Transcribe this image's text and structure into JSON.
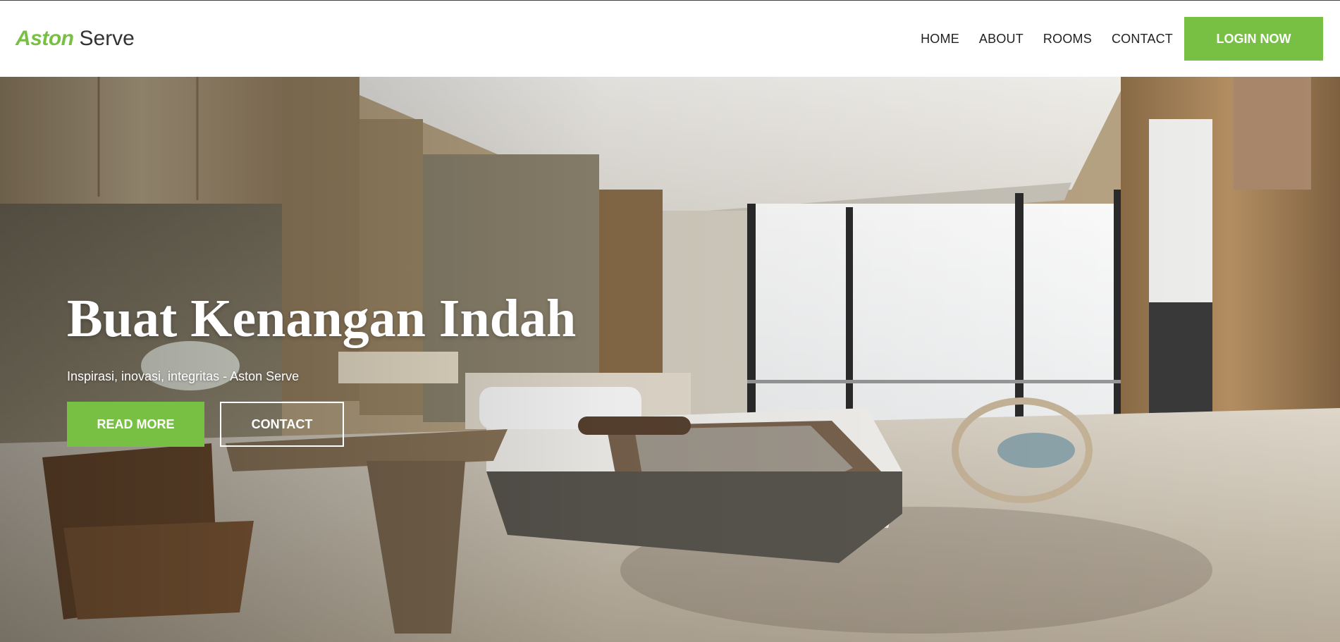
{
  "brand": {
    "primary": "Aston",
    "secondary": "Serve"
  },
  "nav": {
    "links": [
      "HOME",
      "ABOUT",
      "ROOMS",
      "CONTACT"
    ],
    "login_label": "LOGIN NOW"
  },
  "hero": {
    "title": "Buat Kenangan Indah",
    "subtitle": "Inspirasi, inovasi, integritas - Aston Serve",
    "read_more_label": "READ MORE",
    "contact_label": "CONTACT"
  },
  "colors": {
    "accent": "#78c043",
    "nav_text": "#222222",
    "hero_text": "#ffffff"
  }
}
